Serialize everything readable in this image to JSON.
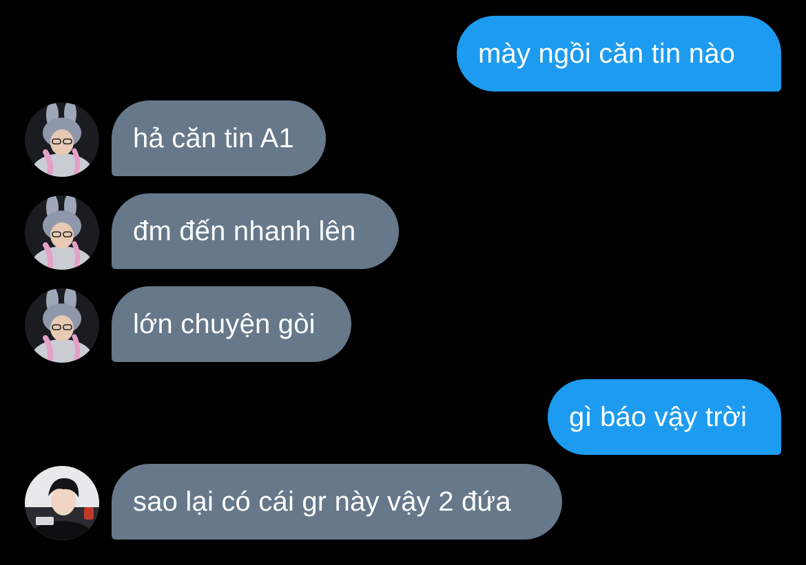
{
  "colors": {
    "background": "#000000",
    "outgoing_bubble": "#1d9bf0",
    "incoming_bubble": "#66788a",
    "text": "#ffffff"
  },
  "messages": [
    {
      "direction": "outgoing",
      "text": "mày ngồi căn tin nào"
    },
    {
      "direction": "incoming",
      "sender_avatar": "avatar-bunny-hat",
      "text": "hả căn tin A1"
    },
    {
      "direction": "incoming",
      "sender_avatar": "avatar-bunny-hat",
      "text": "đm đến nhanh lên"
    },
    {
      "direction": "incoming",
      "sender_avatar": "avatar-bunny-hat",
      "text": "lớn chuyện gòi"
    },
    {
      "direction": "outgoing",
      "text": "gì báo vậy trời"
    },
    {
      "direction": "incoming",
      "sender_avatar": "avatar-dark-hair",
      "text": "sao lại có cái gr này vậy 2 đứa"
    }
  ]
}
